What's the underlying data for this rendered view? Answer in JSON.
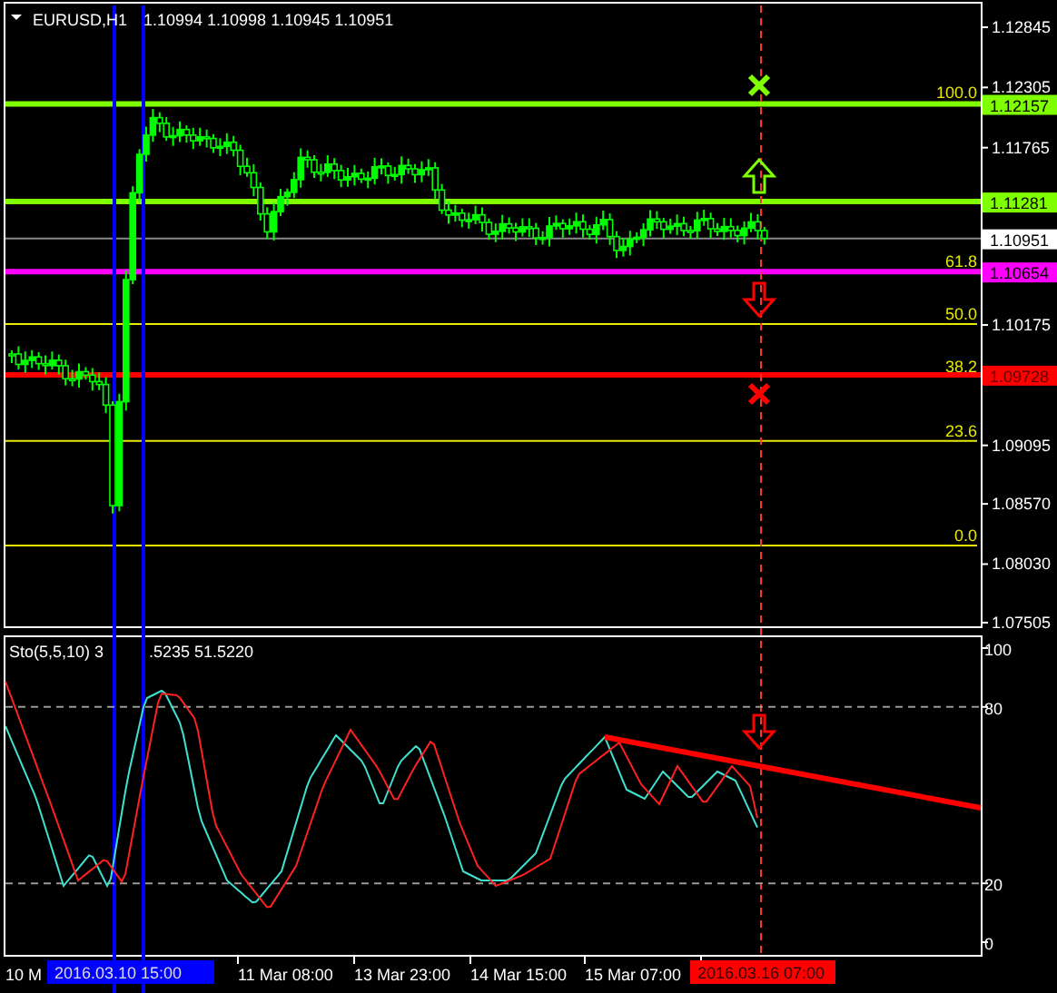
{
  "header": {
    "symbol": "EURUSD,H1",
    "quote": "1.10994 1.10998 1.10945 1.10951"
  },
  "price_axis": [
    "1.12845",
    "1.12305",
    "1.11765",
    "1.10175",
    "1.09095",
    "1.08570",
    "1.08030",
    "1.07505"
  ],
  "price_lines": [
    {
      "label": "1.12157",
      "kind": "level",
      "color": "#80ff00"
    },
    {
      "label": "1.11281",
      "kind": "level",
      "color": "#80ff00"
    },
    {
      "label": "1.10951",
      "kind": "bid",
      "color": "#ffffff"
    },
    {
      "label": "1.10654",
      "kind": "level",
      "color": "#ff00ff"
    },
    {
      "label": "1.09728",
      "kind": "level",
      "color": "#ff0000"
    }
  ],
  "fib_levels": [
    "100.0",
    "61.8",
    "50.0",
    "38.2",
    "23.6",
    "0.0"
  ],
  "markers": [
    {
      "kind": "cross",
      "color": "#80ff00"
    },
    {
      "kind": "arrow_up",
      "color": "#80ff00"
    },
    {
      "kind": "arrow_down",
      "color": "#ff0000"
    },
    {
      "kind": "cross",
      "color": "#ff0000"
    }
  ],
  "indicator": {
    "label": "Sto(5,5,10) 3",
    "values": ".5235 51.5220",
    "axis": [
      "100",
      "80",
      "20",
      "0"
    ],
    "markers": [
      {
        "kind": "arrow_down",
        "color": "#ff0000"
      }
    ]
  },
  "time_axis": [
    {
      "text": "10 M",
      "kind": "tick"
    },
    {
      "text": "2016.03.10 15:00",
      "kind": "tag",
      "color": "#0000ff"
    },
    {
      "text": "11 Mar 08:00",
      "kind": "tick"
    },
    {
      "text": "13 Mar 23:00",
      "kind": "tick"
    },
    {
      "text": "14 Mar 15:00",
      "kind": "tick"
    },
    {
      "text": "15 Mar 07:00",
      "kind": "tick"
    },
    {
      "text": "2016.03.16 07:00",
      "kind": "tag",
      "color": "#ff0000"
    }
  ]
}
